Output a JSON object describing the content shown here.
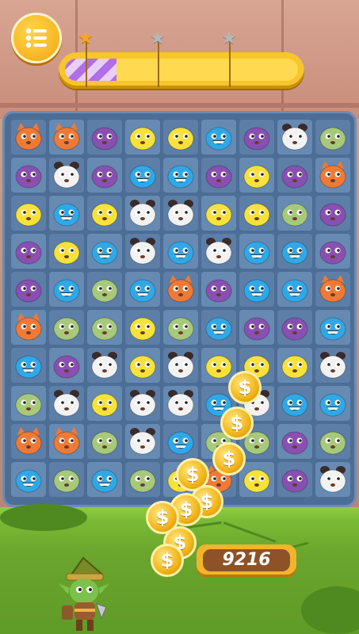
{
  "game": {
    "score": "9216",
    "progress_fraction": 0.22,
    "stars": [
      {
        "state": "earned",
        "icon": "star-gold"
      },
      {
        "state": "locked",
        "icon": "star-silver"
      },
      {
        "state": "locked",
        "icon": "star-silver"
      }
    ],
    "menu_icon": "menu-list-icon",
    "coin_symbol": "$",
    "colors": {
      "board": "#4c6d96",
      "fox": "#f07a35",
      "purple": "#8a4fb2",
      "yellow": "#f7e23a",
      "blue": "#2fa8e8",
      "white": "#f2f2f2",
      "green": "#a6c97a"
    }
  },
  "board": {
    "rows": [
      [
        "fox",
        "fox",
        "purple",
        "yellow",
        "yellow",
        "blue",
        "purple",
        "white",
        "green"
      ],
      [
        "purple",
        "white",
        "purple",
        "blue",
        "blue",
        "purple",
        "yellow",
        "purple",
        "fox"
      ],
      [
        "yellow",
        "blue",
        "yellow",
        "white",
        "white",
        "yellow",
        "yellow",
        "green",
        "purple"
      ],
      [
        "purple",
        "yellow",
        "blue",
        "white",
        "blue",
        "white",
        "blue",
        "blue",
        "purple"
      ],
      [
        "purple",
        "blue",
        "green",
        "blue",
        "fox",
        "purple",
        "blue",
        "blue",
        "fox"
      ],
      [
        "fox",
        "green",
        "green",
        "yellow",
        "green",
        "blue",
        "purple",
        "purple",
        "blue"
      ],
      [
        "blue",
        "purple",
        "white",
        "yellow",
        "white",
        "yellow",
        "yellow",
        "yellow",
        "white"
      ],
      [
        "green",
        "white",
        "yellow",
        "white",
        "white",
        "blue",
        "white",
        "blue",
        "blue"
      ],
      [
        "fox",
        "fox",
        "green",
        "white",
        "blue",
        "green",
        "green",
        "purple",
        "green"
      ],
      [
        "blue",
        "green",
        "blue",
        "green",
        "yellow",
        "fox",
        "yellow",
        "purple",
        "white"
      ]
    ]
  }
}
